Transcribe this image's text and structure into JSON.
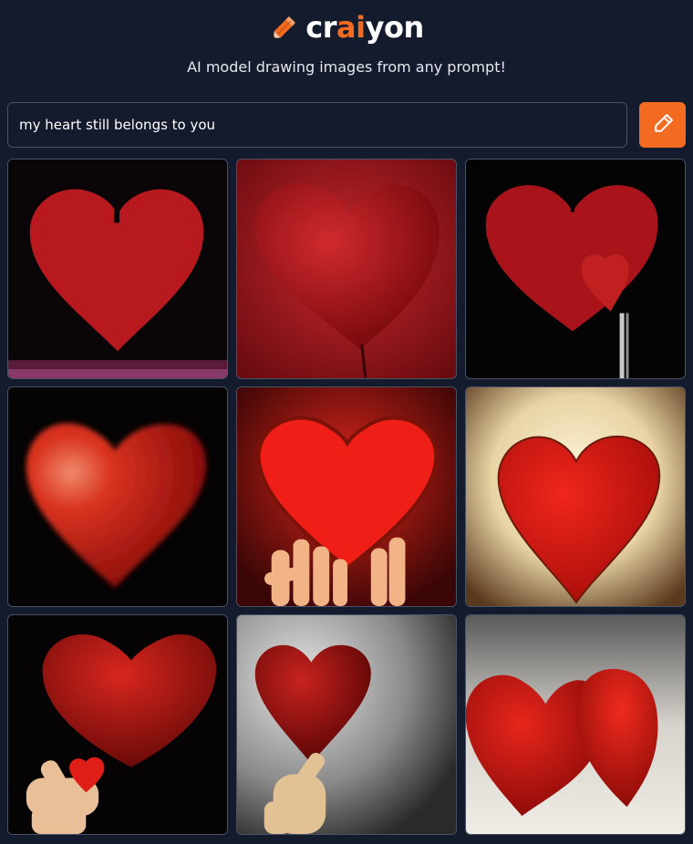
{
  "header": {
    "logo_icon": "pencil-icon",
    "logo_parts": [
      "cr",
      "ai",
      "yon"
    ],
    "tagline": "AI model drawing images from any prompt!",
    "brand_color": "#f26b21"
  },
  "prompt": {
    "value": "my heart still belongs to you",
    "submit_icon": "pencil-icon"
  },
  "images": [
    {
      "label": "Red heart with stem on dark background"
    },
    {
      "label": "Glossy red heart balloon on red background"
    },
    {
      "label": "Large and small red hearts on black"
    },
    {
      "label": "Blurred glowing red heart on black"
    },
    {
      "label": "Hands holding glowing red heart"
    },
    {
      "label": "Red heart on cream glowing background"
    },
    {
      "label": "Red heart floating above hand on black"
    },
    {
      "label": "Hand holding dark red heart on grey"
    },
    {
      "label": "Two red hearts side by side"
    }
  ]
}
